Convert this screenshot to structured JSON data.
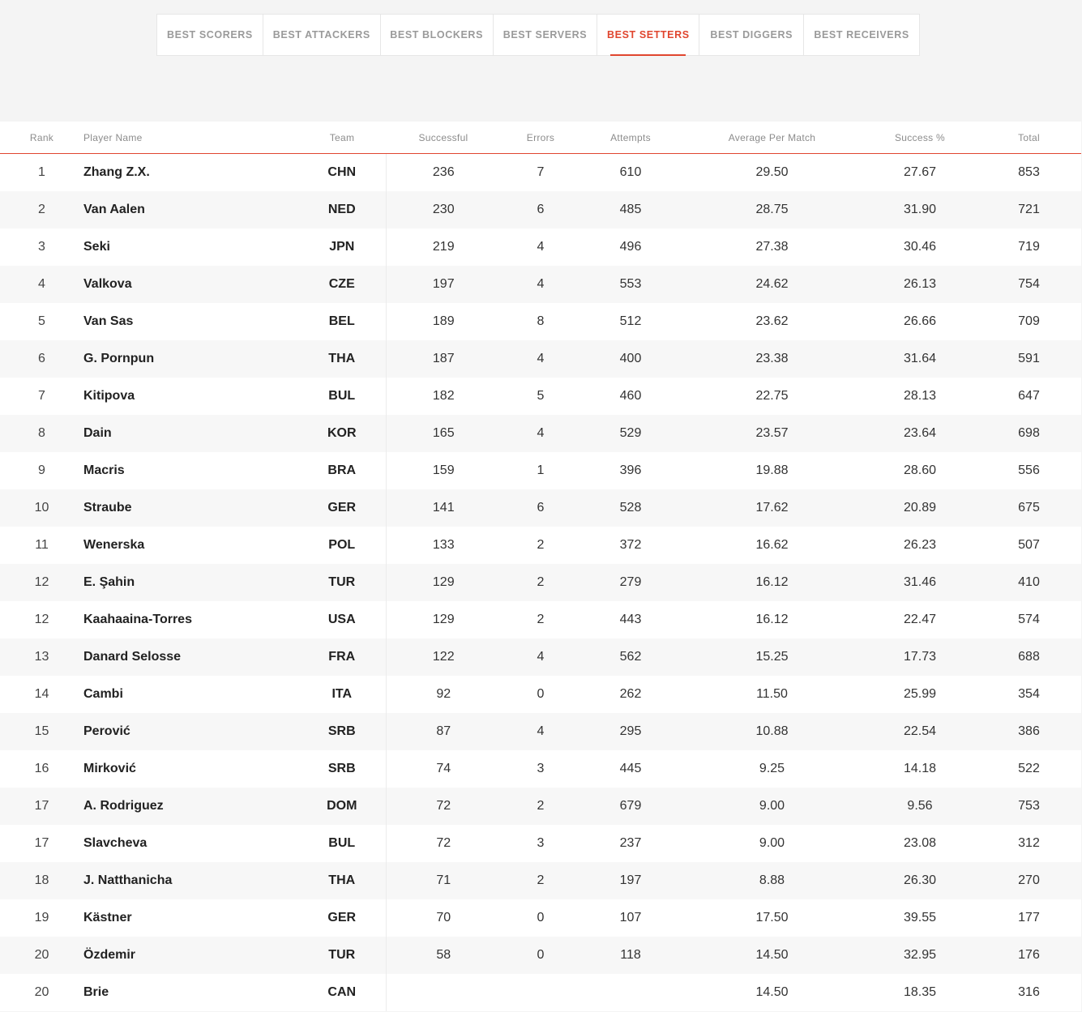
{
  "tabs": [
    {
      "label": "BEST SCORERS",
      "active": false
    },
    {
      "label": "BEST ATTACKERS",
      "active": false
    },
    {
      "label": "BEST BLOCKERS",
      "active": false
    },
    {
      "label": "BEST SERVERS",
      "active": false
    },
    {
      "label": "BEST SETTERS",
      "active": true
    },
    {
      "label": "BEST DIGGERS",
      "active": false
    },
    {
      "label": "BEST RECEIVERS",
      "active": false
    }
  ],
  "colors": {
    "accent": "#e0462f",
    "background": "#f4f4f4",
    "row_alt": "#f7f7f7"
  },
  "table": {
    "headers": [
      "Rank",
      "Player Name",
      "Team",
      "Successful",
      "Errors",
      "Attempts",
      "Average Per Match",
      "Success %",
      "Total"
    ],
    "rows": [
      [
        "1",
        "Zhang Z.X.",
        "CHN",
        "236",
        "7",
        "610",
        "29.50",
        "27.67",
        "853"
      ],
      [
        "2",
        "Van Aalen",
        "NED",
        "230",
        "6",
        "485",
        "28.75",
        "31.90",
        "721"
      ],
      [
        "3",
        "Seki",
        "JPN",
        "219",
        "4",
        "496",
        "27.38",
        "30.46",
        "719"
      ],
      [
        "4",
        "Valkova",
        "CZE",
        "197",
        "4",
        "553",
        "24.62",
        "26.13",
        "754"
      ],
      [
        "5",
        "Van Sas",
        "BEL",
        "189",
        "8",
        "512",
        "23.62",
        "26.66",
        "709"
      ],
      [
        "6",
        "G. Pornpun",
        "THA",
        "187",
        "4",
        "400",
        "23.38",
        "31.64",
        "591"
      ],
      [
        "7",
        "Kitipova",
        "BUL",
        "182",
        "5",
        "460",
        "22.75",
        "28.13",
        "647"
      ],
      [
        "8",
        "Dain",
        "KOR",
        "165",
        "4",
        "529",
        "23.57",
        "23.64",
        "698"
      ],
      [
        "9",
        "Macris",
        "BRA",
        "159",
        "1",
        "396",
        "19.88",
        "28.60",
        "556"
      ],
      [
        "10",
        "Straube",
        "GER",
        "141",
        "6",
        "528",
        "17.62",
        "20.89",
        "675"
      ],
      [
        "11",
        "Wenerska",
        "POL",
        "133",
        "2",
        "372",
        "16.62",
        "26.23",
        "507"
      ],
      [
        "12",
        "E. Şahin",
        "TUR",
        "129",
        "2",
        "279",
        "16.12",
        "31.46",
        "410"
      ],
      [
        "12",
        "Kaahaaina-Torres",
        "USA",
        "129",
        "2",
        "443",
        "16.12",
        "22.47",
        "574"
      ],
      [
        "13",
        "Danard Selosse",
        "FRA",
        "122",
        "4",
        "562",
        "15.25",
        "17.73",
        "688"
      ],
      [
        "14",
        "Cambi",
        "ITA",
        "92",
        "0",
        "262",
        "11.50",
        "25.99",
        "354"
      ],
      [
        "15",
        "Perović",
        "SRB",
        "87",
        "4",
        "295",
        "10.88",
        "22.54",
        "386"
      ],
      [
        "16",
        "Mirković",
        "SRB",
        "74",
        "3",
        "445",
        "9.25",
        "14.18",
        "522"
      ],
      [
        "17",
        "A. Rodriguez",
        "DOM",
        "72",
        "2",
        "679",
        "9.00",
        "9.56",
        "753"
      ],
      [
        "17",
        "Slavcheva",
        "BUL",
        "72",
        "3",
        "237",
        "9.00",
        "23.08",
        "312"
      ],
      [
        "18",
        "J. Natthanicha",
        "THA",
        "71",
        "2",
        "197",
        "8.88",
        "26.30",
        "270"
      ],
      [
        "19",
        "Kästner",
        "GER",
        "70",
        "0",
        "107",
        "17.50",
        "39.55",
        "177"
      ],
      [
        "20",
        "Özdemir",
        "TUR",
        "58",
        "0",
        "118",
        "14.50",
        "32.95",
        "176"
      ],
      [
        "20",
        "Brie",
        "CAN",
        "",
        "",
        "",
        "14.50",
        "18.35",
        "316"
      ]
    ]
  }
}
